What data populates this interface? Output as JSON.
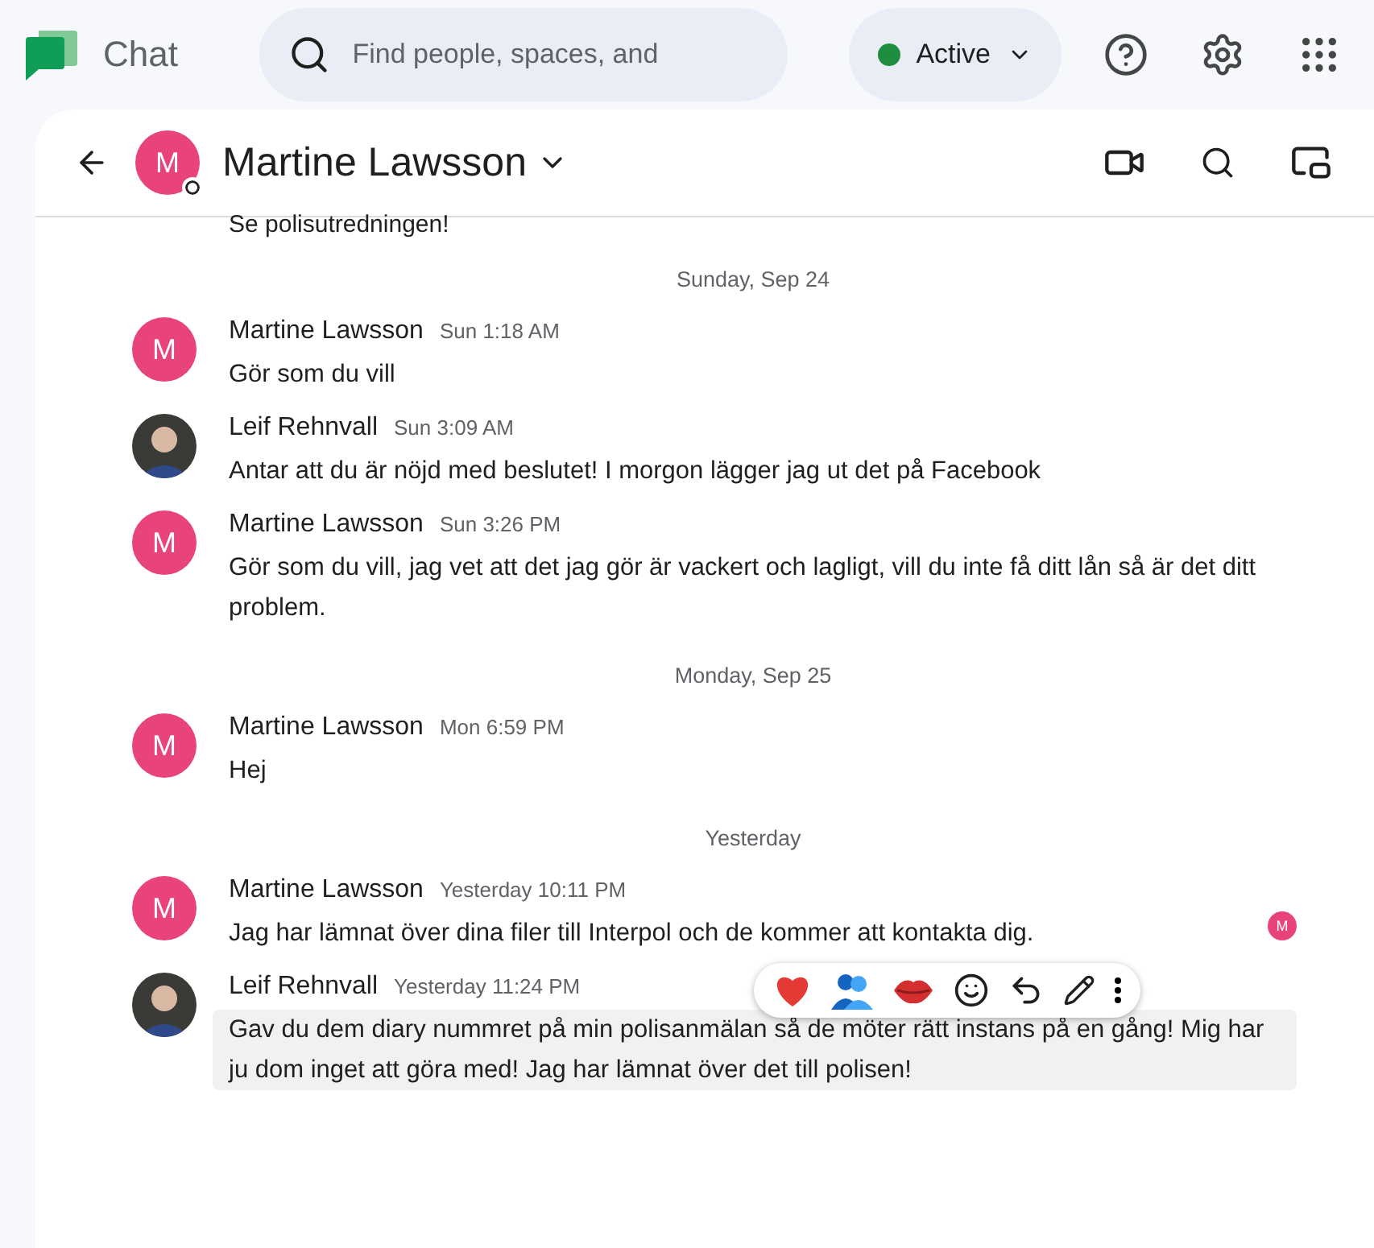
{
  "app": {
    "name": "Chat"
  },
  "search": {
    "placeholder": "Find people, spaces, and"
  },
  "status": {
    "label": "Active",
    "on": true
  },
  "conversation": {
    "title": "Martine Lawsson",
    "initial": "M"
  },
  "feed": [
    {
      "kind": "text-only",
      "text": "Se polisutredningen!"
    },
    {
      "kind": "date",
      "label": "Sunday, Sep 24"
    },
    {
      "kind": "message",
      "sender": "Martine Lawsson",
      "time": "Sun 1:18 AM",
      "initial": "M",
      "text": "Gör som du vill",
      "highlighted": false
    },
    {
      "kind": "message",
      "sender": "Leif Rehnvall",
      "time": "Sun 3:09 AM",
      "text": "Antar att du är nöjd med beslutet! I morgon lägger jag ut det på Facebook",
      "highlighted": false
    },
    {
      "kind": "message",
      "sender": "Martine Lawsson",
      "time": "Sun 3:26 PM",
      "initial": "M",
      "text": "Gör som du vill, jag vet att det jag gör är vackert och lagligt, vill du inte få ditt lån så är det ditt problem.",
      "highlighted": false
    },
    {
      "kind": "date",
      "label": "Monday, Sep 25"
    },
    {
      "kind": "message",
      "sender": "Martine Lawsson",
      "time": "Mon 6:59 PM",
      "initial": "M",
      "text": "Hej",
      "highlighted": false
    },
    {
      "kind": "date",
      "label": "Yesterday"
    },
    {
      "kind": "message",
      "sender": "Martine Lawsson",
      "time": "Yesterday 10:11 PM",
      "initial": "M",
      "text": "Jag har lämnat över dina filer till Interpol och de kommer att kontakta dig.",
      "highlighted": false,
      "read_receipt": "M"
    },
    {
      "kind": "message",
      "sender": "Leif Rehnvall",
      "time": "Yesterday 11:24 PM",
      "text": "Gav du dem diary nummret på min polisanmälan så de möter rätt instans på en gång! Mig har ju dom inget att göra med! Jag har lämnat över det till polisen!",
      "highlighted": true
    }
  ]
}
